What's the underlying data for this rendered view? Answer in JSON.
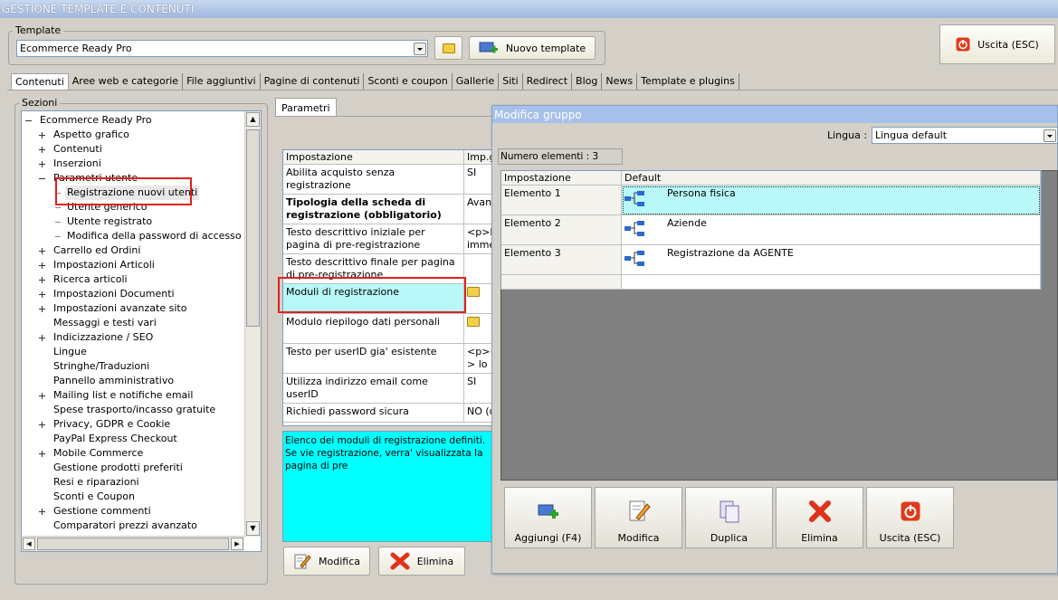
{
  "window": {
    "title": "GESTIONE TEMPLATE E CONTENUTI"
  },
  "template_group": {
    "legend": "Template",
    "selected": "Ecommerce Ready Pro",
    "new_label": "Nuovo template"
  },
  "exit_label": "Uscita (ESC)",
  "tabs": [
    {
      "label": "Contenuti"
    },
    {
      "label": "Aree web e categorie"
    },
    {
      "label": "File aggiuntivi"
    },
    {
      "label": "Pagine di contenuti"
    },
    {
      "label": "Sconti e coupon"
    },
    {
      "label": "Gallerie"
    },
    {
      "label": "Siti"
    },
    {
      "label": "Redirect"
    },
    {
      "label": "Blog"
    },
    {
      "label": "News"
    },
    {
      "label": "Template e plugins"
    }
  ],
  "sections": {
    "legend": "Sezioni",
    "items": [
      {
        "label": "Ecommerce Ready Pro",
        "level": 0,
        "expander": "minus"
      },
      {
        "label": "Aspetto grafico",
        "level": 1,
        "expander": "plus"
      },
      {
        "label": "Contenuti",
        "level": 1,
        "expander": "plus"
      },
      {
        "label": "Inserzioni",
        "level": 1,
        "expander": "plus"
      },
      {
        "label": "Parametri utente",
        "level": 1,
        "expander": "minus"
      },
      {
        "label": "Registrazione nuovi utenti",
        "level": 2,
        "expander": "",
        "selected": true
      },
      {
        "label": "Utente generico",
        "level": 2,
        "expander": ""
      },
      {
        "label": "Utente registrato",
        "level": 2,
        "expander": ""
      },
      {
        "label": "Modifica della password di accesso",
        "level": 2,
        "expander": ""
      },
      {
        "label": "Carrello ed Ordini",
        "level": 1,
        "expander": "plus"
      },
      {
        "label": "Impostazioni Articoli",
        "level": 1,
        "expander": "plus"
      },
      {
        "label": "Ricerca articoli",
        "level": 1,
        "expander": "plus"
      },
      {
        "label": "Impostazioni Documenti",
        "level": 1,
        "expander": "plus"
      },
      {
        "label": "Impostazioni avanzate sito",
        "level": 1,
        "expander": "plus"
      },
      {
        "label": "Messaggi e testi vari",
        "level": 1,
        "expander": ""
      },
      {
        "label": "Indicizzazione / SEO",
        "level": 1,
        "expander": "plus"
      },
      {
        "label": "Lingue",
        "level": 1,
        "expander": ""
      },
      {
        "label": "Stringhe/Traduzioni",
        "level": 1,
        "expander": ""
      },
      {
        "label": "Pannello amministrativo",
        "level": 1,
        "expander": ""
      },
      {
        "label": "Mailing list e notifiche email",
        "level": 1,
        "expander": "plus"
      },
      {
        "label": "Spese trasporto/incasso gratuite",
        "level": 1,
        "expander": ""
      },
      {
        "label": "Privacy, GDPR e Cookie",
        "level": 1,
        "expander": "plus"
      },
      {
        "label": "PayPal Express Checkout",
        "level": 1,
        "expander": ""
      },
      {
        "label": "Mobile Commerce",
        "level": 1,
        "expander": "plus"
      },
      {
        "label": "Gestione prodotti preferiti",
        "level": 1,
        "expander": ""
      },
      {
        "label": "Resi e riparazioni",
        "level": 1,
        "expander": ""
      },
      {
        "label": "Sconti e Coupon",
        "level": 1,
        "expander": ""
      },
      {
        "label": "Gestione commenti",
        "level": 1,
        "expander": "plus"
      },
      {
        "label": "Comparatori prezzi avanzato",
        "level": 1,
        "expander": ""
      }
    ]
  },
  "params": {
    "tab": "Parametri",
    "col_setting": "Impostazione",
    "col_value": "Imp.g",
    "rows": [
      {
        "name": "Abilita acquisto senza registrazione",
        "value": "SI",
        "bold": false
      },
      {
        "name": "Tipologia della scheda di registrazione (obbligatorio)",
        "value": "Avanz",
        "bold": true
      },
      {
        "name": "Testo descrittivo iniziale per pagina di pre-registrazione",
        "value": "<p>L\nimmed",
        "bold": false
      },
      {
        "name": "Testo descrittivo finale per pagina di pre-registrazione",
        "value": "",
        "bold": false
      },
      {
        "name": "Moduli di registrazione",
        "value": "",
        "bold": false,
        "icon": true,
        "selected": true
      },
      {
        "name": "Modulo riepilogo dati personali",
        "value": "",
        "bold": false,
        "icon": true
      },
      {
        "name": "Testo per userID gia' esistente",
        "value": "<p><\n> lo u",
        "bold": false
      },
      {
        "name": "Utilizza indirizzo email come userID",
        "value": "SI",
        "bold": false
      },
      {
        "name": "Richiedi password sicura",
        "value": "NO (d",
        "bold": false
      }
    ],
    "description": "Elenco dei moduli di registrazione definiti. Se vie registrazione, verra' visualizzata la pagina di pre",
    "modify_label": "Modifica",
    "delete_label": "Elimina"
  },
  "dialog": {
    "title": "Modifica gruppo",
    "lang_label": "Lingua :",
    "lang_value": "Lingua default",
    "count": "Numero elementi : 3",
    "col_setting": "Impostazione",
    "col_default": "Default",
    "rows": [
      {
        "name": "Elemento 1",
        "value": "Persona fisica"
      },
      {
        "name": "Elemento 2",
        "value": "Aziende"
      },
      {
        "name": "Elemento 3",
        "value": "Registrazione da AGENTE"
      }
    ],
    "buttons": {
      "add": "Aggiungi (F4)",
      "modify": "Modifica",
      "duplicate": "Duplica",
      "delete": "Elimina",
      "exit": "Uscita (ESC)"
    }
  },
  "colors": {
    "highlight": "#b8f8f8",
    "cyan": "#00ffff",
    "red_box": "#e02020",
    "dialog_title": "#a6c0ea"
  }
}
